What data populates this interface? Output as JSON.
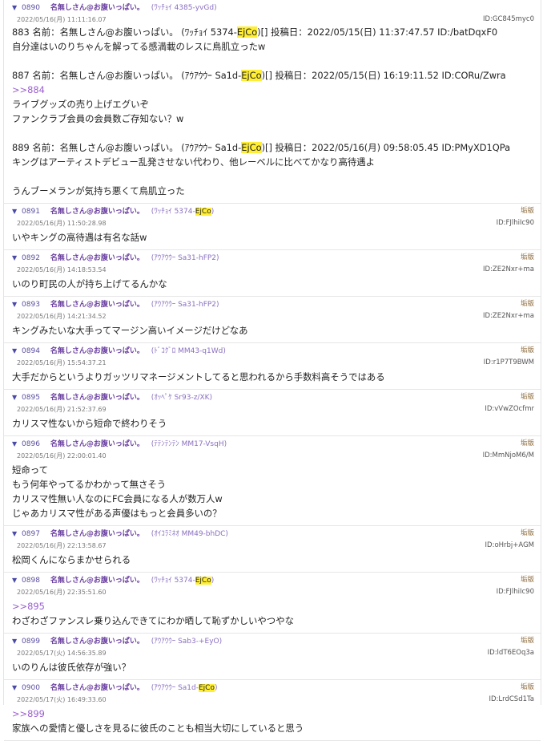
{
  "posts": [
    {
      "num": "0890",
      "name": "名無しさん@お腹いっぱい。",
      "idtag_pre": "(ﾜｯﾁｮｲ 4385-yvGd)",
      "idtag_hl": "",
      "idtag_post": "",
      "report": "",
      "date": "2022/05/16(月) 11:11:16.07",
      "uid": "ID:GC845myc0",
      "lines": [
        {
          "pre": "883 名前：名無しさん@お腹いっぱい。 (ﾜｯﾁｮｲ 5374-",
          "hl": "EjCo",
          "post": ")[] 投稿日：2022/05/15(日) 11:37:47.57 ID:/batDqxF0",
          "anchor": false
        },
        {
          "pre": "自分達はいのりちゃんを解ってる感満載のレスに鳥肌立ったw",
          "hl": "",
          "post": "",
          "anchor": false
        },
        {
          "pre": "",
          "hl": "",
          "post": "",
          "anchor": false
        },
        {
          "pre": "887 名前：名無しさん@お腹いっぱい。 (ｱｳｱｳｳｰ Sa1d-",
          "hl": "EjCo",
          "post": ")[] 投稿日：2022/05/15(日) 16:19:11.52 ID:CORu/Zwra",
          "anchor": false
        },
        {
          "pre": ">>884",
          "hl": "",
          "post": "",
          "anchor": true
        },
        {
          "pre": "ライブグッズの売り上げエグいぞ",
          "hl": "",
          "post": "",
          "anchor": false
        },
        {
          "pre": "ファンクラブ会員の会員数ご存知ない？w",
          "hl": "",
          "post": "",
          "anchor": false
        },
        {
          "pre": "",
          "hl": "",
          "post": "",
          "anchor": false
        },
        {
          "pre": "889 名前：名無しさん@お腹いっぱい。 (ｱｳｱｳｳｰ Sa1d-",
          "hl": "EjCo",
          "post": ")[] 投稿日：2022/05/16(月) 09:58:05.45 ID:PMyXD1QPa",
          "anchor": false
        },
        {
          "pre": "キングはアーティストデビュー乱発させない代わり、他レーベルに比べてかなり高待遇よ",
          "hl": "",
          "post": "",
          "anchor": false
        },
        {
          "pre": "",
          "hl": "",
          "post": "",
          "anchor": false
        },
        {
          "pre": "うんブーメランが気持ち悪くて鳥肌立った",
          "hl": "",
          "post": "",
          "anchor": false
        }
      ]
    },
    {
      "num": "0891",
      "name": "名無しさん@お腹いっぱい。",
      "idtag_pre": "(ﾜｯﾁｮｲ 5374-",
      "idtag_hl": "EjCo",
      "idtag_post": ")",
      "report": "垢版",
      "date": "2022/05/16(月) 11:50:28.98",
      "uid": "ID:FJlhiIc90",
      "lines": [
        {
          "pre": "いやキングの高待遇は有名な話w",
          "hl": "",
          "post": "",
          "anchor": false
        }
      ]
    },
    {
      "num": "0892",
      "name": "名無しさん@お腹いっぱい。",
      "idtag_pre": "(ｱｳｱｳｳｰ Sa31-hFP2)",
      "idtag_hl": "",
      "idtag_post": "",
      "report": "垢版",
      "date": "2022/05/16(月) 14:18:53.54",
      "uid": "ID:ZE2Nxr+ma",
      "lines": [
        {
          "pre": "いのり町民の人が持ち上げてるんかな",
          "hl": "",
          "post": "",
          "anchor": false
        }
      ]
    },
    {
      "num": "0893",
      "name": "名無しさん@お腹いっぱい。",
      "idtag_pre": "(ｱｳｱｳｳｰ Sa31-hFP2)",
      "idtag_hl": "",
      "idtag_post": "",
      "report": "垢版",
      "date": "2022/05/16(月) 14:21:34.52",
      "uid": "ID:ZE2Nxr+ma",
      "lines": [
        {
          "pre": "キングみたいな大手ってマージン高いイメージだけどなあ",
          "hl": "",
          "post": "",
          "anchor": false
        }
      ]
    },
    {
      "num": "0894",
      "name": "名無しさん@お腹いっぱい。",
      "idtag_pre": "(ﾄﾞｺｸﾞﾛ MM43-q1Wd)",
      "idtag_hl": "",
      "idtag_post": "",
      "report": "垢版",
      "date": "2022/05/16(月) 15:54:37.21",
      "uid": "ID:r1P7T9BWM",
      "lines": [
        {
          "pre": "大手だからというよりガッツリマネージメントしてると思われるから手数料高そうではある",
          "hl": "",
          "post": "",
          "anchor": false
        }
      ]
    },
    {
      "num": "0895",
      "name": "名無しさん@お腹いっぱい。",
      "idtag_pre": "(ｵｯﾍﾟｹ Sr93-z/XK)",
      "idtag_hl": "",
      "idtag_post": "",
      "report": "垢版",
      "date": "2022/05/16(月) 21:52:37.69",
      "uid": "ID:vVwZOcfmr",
      "lines": [
        {
          "pre": "カリスマ性ないから短命で終わりそう",
          "hl": "",
          "post": "",
          "anchor": false
        }
      ]
    },
    {
      "num": "0896",
      "name": "名無しさん@お腹いっぱい。",
      "idtag_pre": "(ﾃﾃﾝﾃﾝﾃﾝ MM17-VsqH)",
      "idtag_hl": "",
      "idtag_post": "",
      "report": "垢版",
      "date": "2022/05/16(月) 22:00:01.40",
      "uid": "ID:MmNjoM6/M",
      "lines": [
        {
          "pre": "短命って",
          "hl": "",
          "post": "",
          "anchor": false
        },
        {
          "pre": "もう何年やってるかわかって無さそう",
          "hl": "",
          "post": "",
          "anchor": false
        },
        {
          "pre": "カリスマ性無い人なのにFC会員になる人が数万人w",
          "hl": "",
          "post": "",
          "anchor": false
        },
        {
          "pre": "じゃあカリスマ性がある声優はもっと会員多いの？",
          "hl": "",
          "post": "",
          "anchor": false
        }
      ]
    },
    {
      "num": "0897",
      "name": "名無しさん@お腹いっぱい。",
      "idtag_pre": "(ｵｲｺﾗﾐﾈｵ MM49-bhDC)",
      "idtag_hl": "",
      "idtag_post": "",
      "report": "垢版",
      "date": "2022/05/16(月) 22:13:58.67",
      "uid": "ID:oHrbj+AGM",
      "lines": [
        {
          "pre": "松岡くんにならまかせられる",
          "hl": "",
          "post": "",
          "anchor": false
        }
      ]
    },
    {
      "num": "0898",
      "name": "名無しさん@お腹いっぱい。",
      "idtag_pre": "(ﾜｯﾁｮｲ 5374-",
      "idtag_hl": "EjCo",
      "idtag_post": ")",
      "report": "垢版",
      "date": "2022/05/16(月) 22:35:51.60",
      "uid": "ID:FJlhiIc90",
      "lines": [
        {
          "pre": ">>895",
          "hl": "",
          "post": "",
          "anchor": true
        },
        {
          "pre": "わざわざファンスレ乗り込んできてにわか晒して恥ずかしいやつやな",
          "hl": "",
          "post": "",
          "anchor": false
        }
      ]
    },
    {
      "num": "0899",
      "name": "名無しさん@お腹いっぱい。",
      "idtag_pre": "(ｱｳｱｳｳｰ Sab3-+EyO)",
      "idtag_hl": "",
      "idtag_post": "",
      "report": "垢版",
      "date": "2022/05/17(火) 14:56:35.89",
      "uid": "ID:ldT6EOq3a",
      "lines": [
        {
          "pre": "いのりんは彼氏依存が強い？",
          "hl": "",
          "post": "",
          "anchor": false
        }
      ]
    },
    {
      "num": "0900",
      "name": "名無しさん@お腹いっぱい。",
      "idtag_pre": "(ｱｳｱｳｳｰ Sa1d-",
      "idtag_hl": "EjCo",
      "idtag_post": ")",
      "report": "垢版",
      "date": "2022/05/17(火) 16:49:33.60",
      "uid": "ID:LrdCSd1Ta",
      "lines": [
        {
          "pre": ">>899",
          "hl": "",
          "post": "",
          "anchor": true
        },
        {
          "pre": "家族への愛情と優しさを見るに彼氏のことも相当大切にしていると思う",
          "hl": "",
          "post": "",
          "anchor": false
        }
      ]
    }
  ]
}
